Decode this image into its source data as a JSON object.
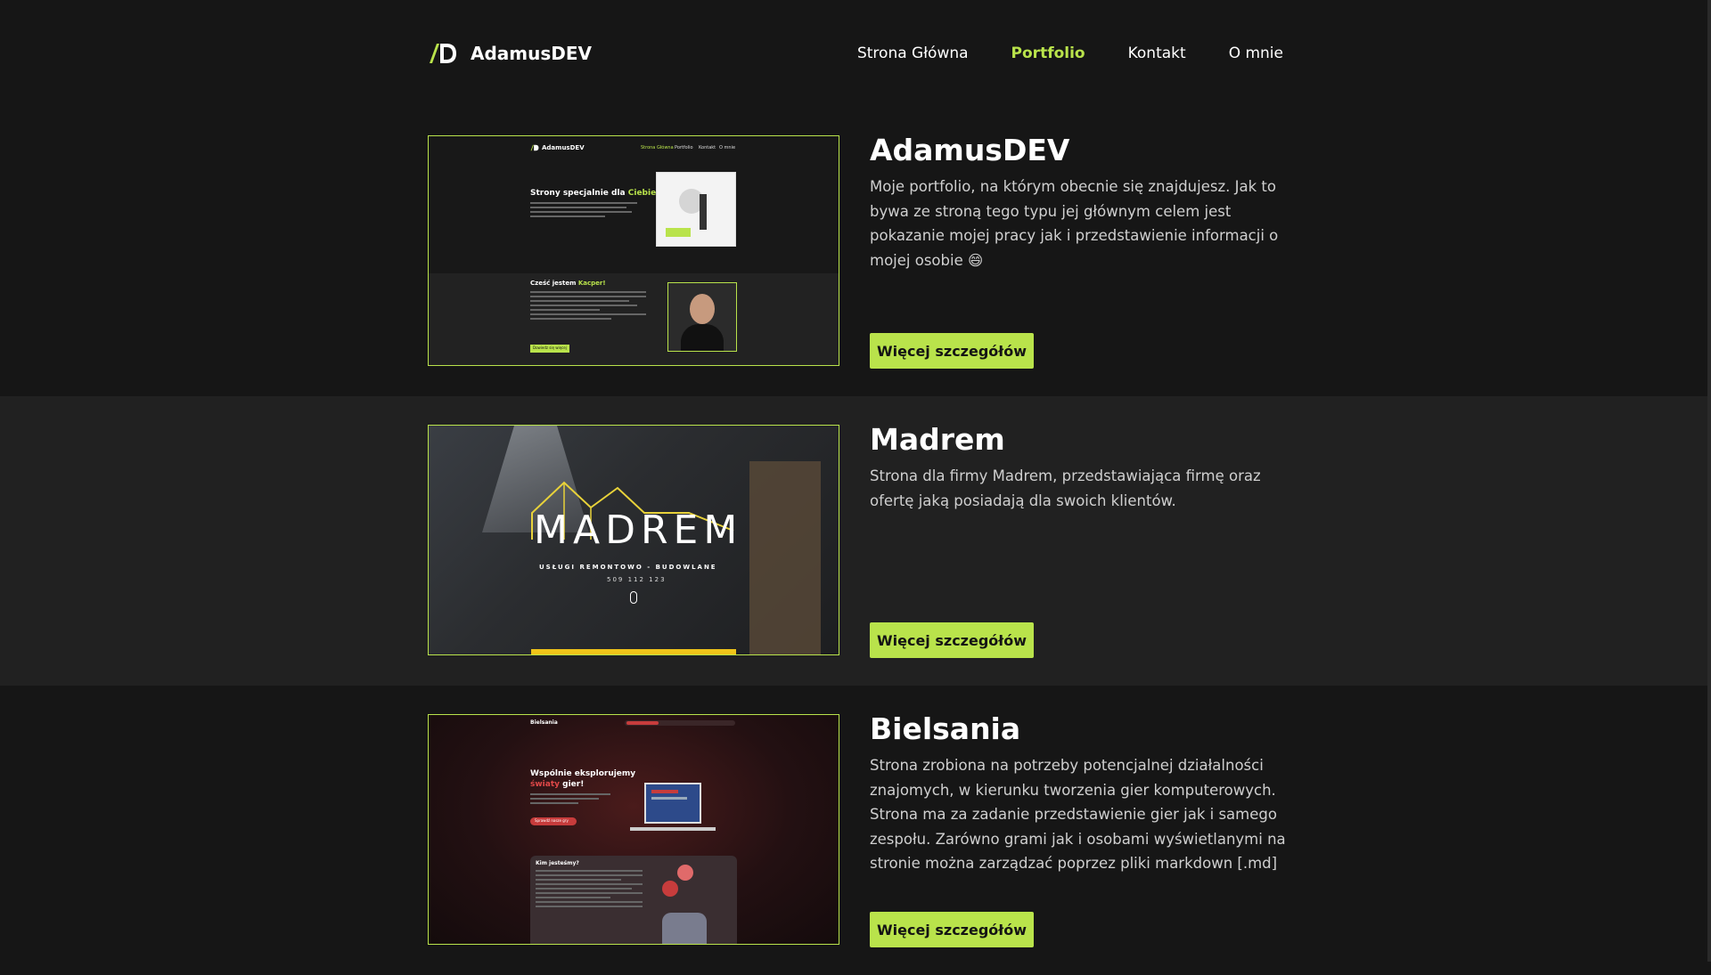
{
  "header": {
    "brand": "AdamusDEV",
    "nav": [
      {
        "label": "Strona Główna",
        "active": false
      },
      {
        "label": "Portfolio",
        "active": true
      },
      {
        "label": "Kontakt",
        "active": false
      },
      {
        "label": "O mnie",
        "active": false
      }
    ]
  },
  "colors": {
    "accent": "#b9e34b",
    "background": "#161616",
    "section_alt": "#212121"
  },
  "projects": [
    {
      "title": "AdamusDEV",
      "description": "Moje portfolio, na którym obecnie się znajdujesz. Jak to bywa ze stroną tego typu jej głównym celem jest pokazanie mojej pracy jak i przedstawienie informacji o mojej osobie 😄",
      "button": "Więcej szczegółów",
      "thumb": {
        "brand": "AdamusDEV",
        "nav": [
          "Strona Główna",
          "Portfolio",
          "Kontakt",
          "O mnie"
        ],
        "hero_title": "Strony specjalnie dla",
        "hero_highlight": "Ciebie",
        "about_title": "Cześć jestem",
        "about_highlight": "Kacper!",
        "about_button": "Dowiedz się więcej"
      }
    },
    {
      "title": "Madrem",
      "description": "Strona dla firmy Madrem, przedstawiająca firmę oraz ofertę jaką posiadają dla swoich klientów.",
      "button": "Więcej szczegółów",
      "thumb": {
        "logo": "MADREM",
        "tagline": "USŁUGI REMONTOWO - BUDOWLANE",
        "phone": "509 112 123"
      }
    },
    {
      "title": "Bielsania",
      "description": "Strona zrobiona na potrzeby potencjalnej działalności znajomych, w kierunku tworzenia gier komputerowych. Strona ma za zadanie przedstawienie gier jak i samego zespołu. Zarówno grami jak i osobami wyświetlanymi na stronie można zarządzać poprzez pliki markdown [.md]",
      "button": "Więcej szczegółów",
      "thumb": {
        "brand": "Bielsania",
        "hero_title": "Wspólnie eksplorujemy",
        "hero_highlight": "światy",
        "hero_end": "gier!",
        "hero_button": "Sprawdź nasze gry",
        "about_title": "Kim jesteśmy?"
      }
    }
  ]
}
